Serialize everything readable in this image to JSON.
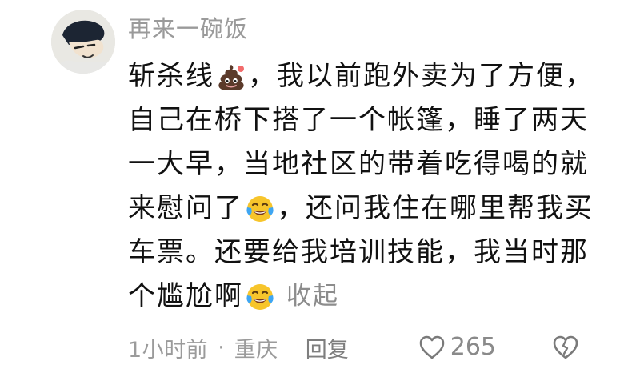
{
  "comment": {
    "username": "再来一碗饭",
    "avatar_icon": "cartoon-avatar",
    "body": {
      "line1_before": "斩杀线",
      "line1_emoji": "poop-emoji",
      "line1_after": "，我以前跑外卖为了方便，",
      "line2": "自己在桥下搭了一个帐篷，睡了两天",
      "line3": "一大早，当地社区的带着吃得喝的就",
      "line4_before": "来慰问了",
      "line4_emoji": "laughing-crying-emoji",
      "line4_after": "，还问我住在哪里帮我买",
      "line5": "车票。还要给我培训技能，我当时那",
      "line6_before": "个尴尬啊",
      "line6_emoji": "laughing-crying-emoji"
    },
    "collapse_label": "收起",
    "footer": {
      "time": "1小时前",
      "separator": "·",
      "location": "重庆",
      "reply_label": "回复",
      "like_count": "265",
      "like_icon": "heart-outline-icon",
      "dislike_icon": "broken-heart-icon"
    },
    "colors": {
      "text": "#111111",
      "muted": "#9a9a9a",
      "emoji_yellow": "#f7c52b",
      "emoji_tear": "#3fa6f2",
      "poop_brown": "#5b3a2a"
    }
  }
}
